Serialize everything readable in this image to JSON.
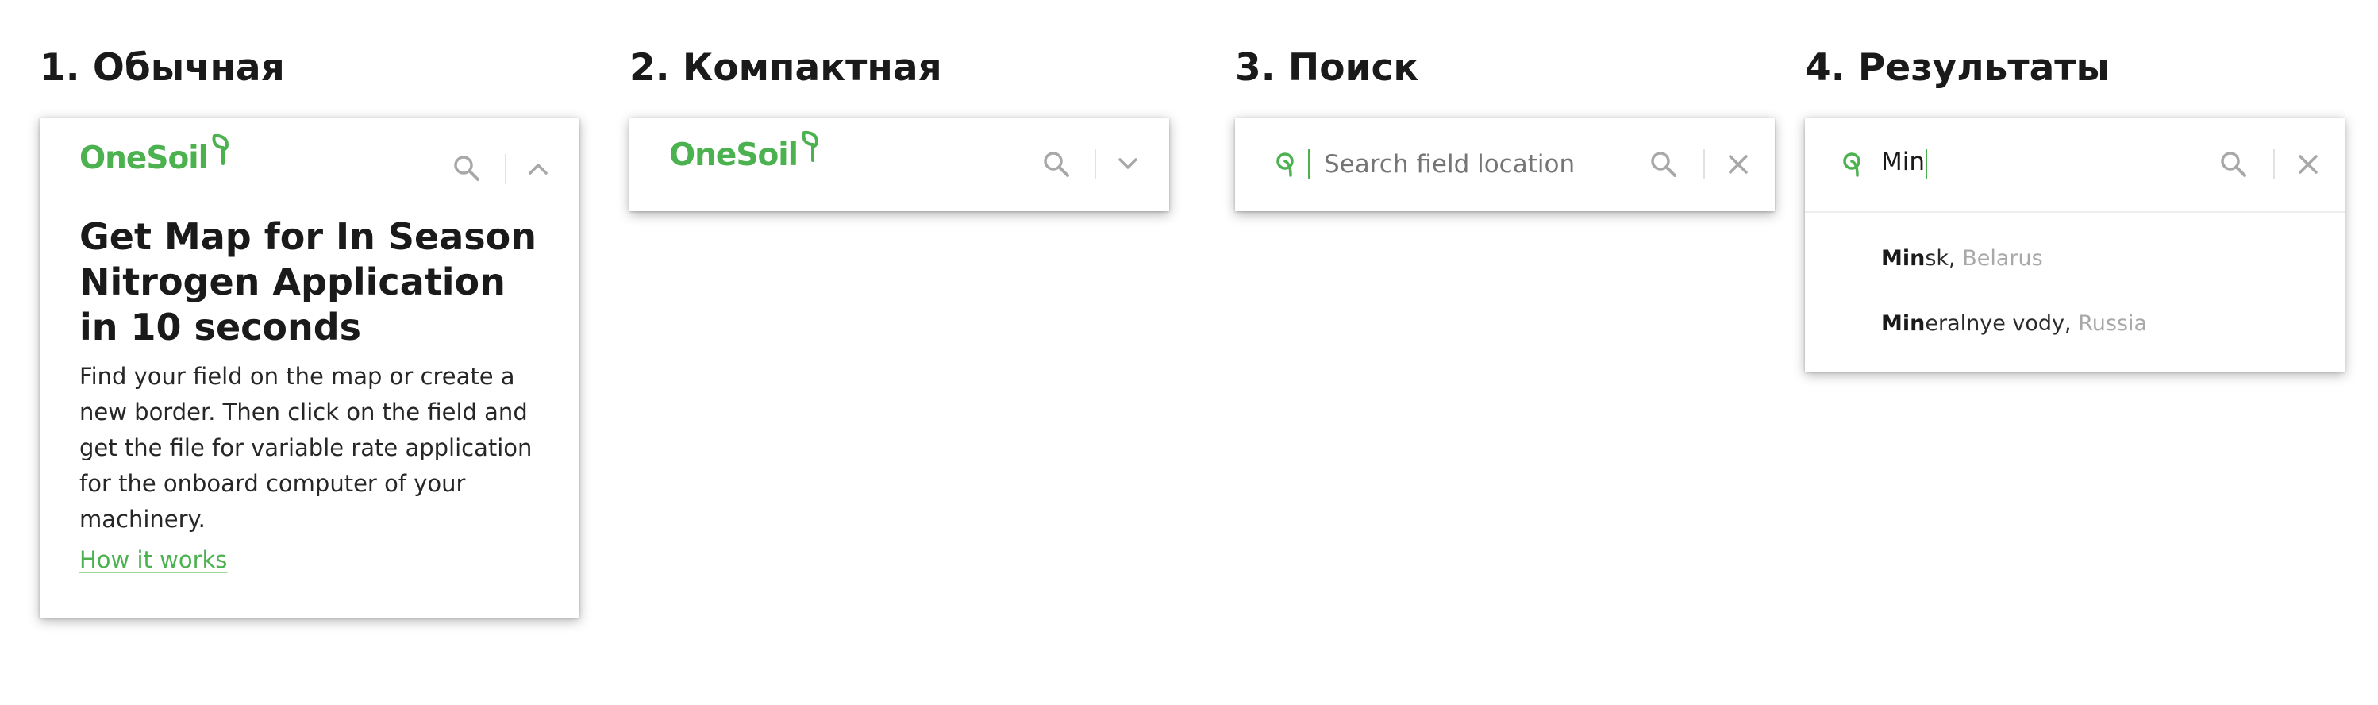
{
  "variants": [
    {
      "title": "1. Обычная"
    },
    {
      "title": "2. Компактная"
    },
    {
      "title": "3. Поиск"
    },
    {
      "title": "4. Результаты"
    }
  ],
  "brand": {
    "name": "OneSoil",
    "color": "#4cb14f"
  },
  "panel_full": {
    "headline": "Get Map for In Season Nitrogen Application in 10 seconds",
    "description": "Find your field on the map or create a new border. Then click on the field and get the file for variable rate application for the onboard computer of your machinery.",
    "link_label": "How it works",
    "icons": [
      "search-icon",
      "chevron-up-icon"
    ]
  },
  "panel_compact": {
    "icons": [
      "search-icon",
      "chevron-down-icon"
    ]
  },
  "panel_search": {
    "placeholder": "Search field location",
    "icons": [
      "leaf-icon",
      "search-icon",
      "close-icon"
    ]
  },
  "panel_results": {
    "query": "Min",
    "results": [
      {
        "match": "Min",
        "rest": "sk, ",
        "country": "Belarus"
      },
      {
        "match": "Min",
        "rest": "eralnye vody, ",
        "country": "Russia"
      }
    ],
    "icons": [
      "leaf-icon",
      "search-icon",
      "close-icon"
    ]
  }
}
